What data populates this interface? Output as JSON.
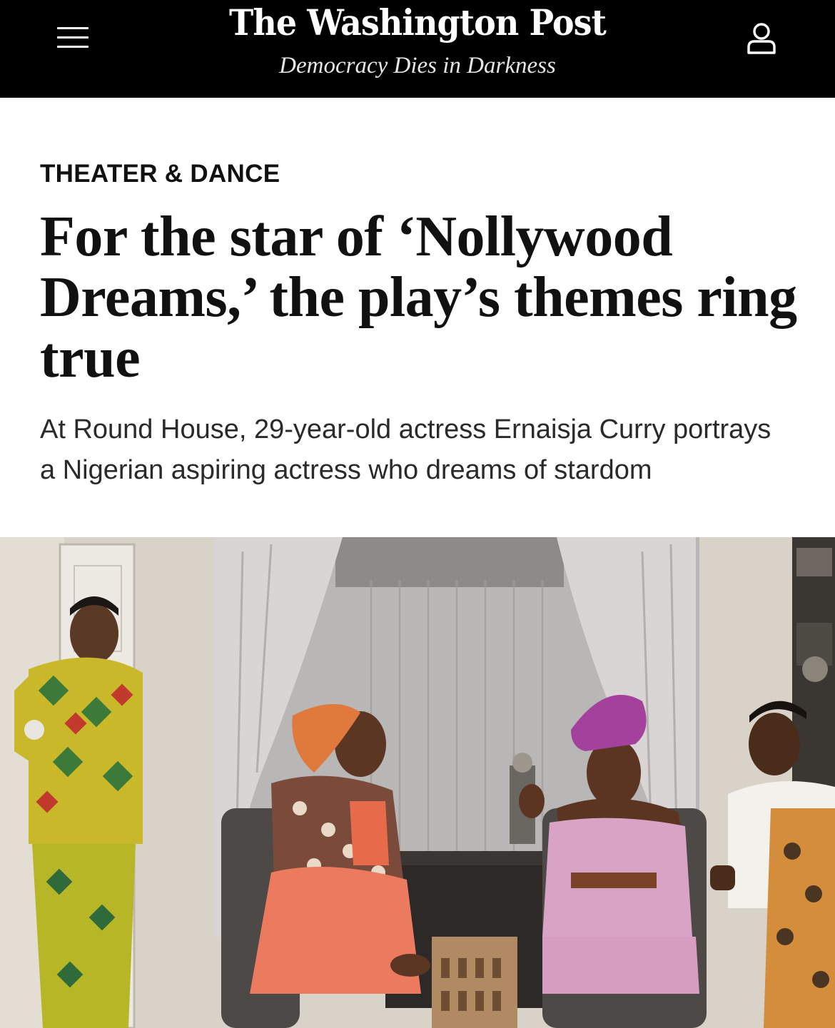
{
  "header": {
    "logo": "The Washington Post",
    "tagline": "Democracy Dies in Darkness",
    "menu_icon": "hamburger-menu-icon",
    "account_icon": "user-account-icon"
  },
  "article": {
    "section": "THEATER & DANCE",
    "headline": "For the star of ‘Nollywood Dreams,’ the play’s themes ring true",
    "dek": "At Round House, 29-year-old actress Ernaisja Curry portrays a Nigerian aspiring actress who dreams of stardom"
  },
  "colors": {
    "masthead_bg": "#000000",
    "text": "#111111"
  }
}
